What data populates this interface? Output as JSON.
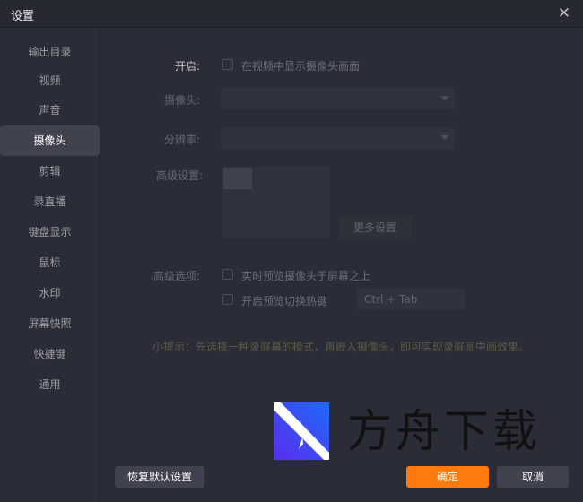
{
  "window": {
    "title": "设置"
  },
  "sidebar": {
    "items": [
      {
        "label": "输出目录"
      },
      {
        "label": "视频"
      },
      {
        "label": "声音"
      },
      {
        "label": "摄像头",
        "active": true
      },
      {
        "label": "剪辑"
      },
      {
        "label": "录直播"
      },
      {
        "label": "键盘显示"
      },
      {
        "label": "鼠标"
      },
      {
        "label": "水印"
      },
      {
        "label": "屏幕快照"
      },
      {
        "label": "快捷键"
      },
      {
        "label": "通用"
      }
    ]
  },
  "camera": {
    "enable_label": "开启:",
    "enable_checkbox": "在视频中显示摄像头画面",
    "camera_label": "摄像头:",
    "camera_value": "",
    "resolution_label": "分辨率:",
    "resolution_value": "",
    "advanced_settings_label": "高级设置:",
    "more_settings": "更多设置",
    "advanced_options_label": "高级选项:",
    "option_preview_on_top": "实时预览摄像头于屏幕之上",
    "option_toggle_hotkey": "开启预览切换热键",
    "hotkey_value": "Ctrl + Tab",
    "tip": "小提示：先选择一种录屏幕的模式，再嵌入摄像头，即可实现录屏画中画效果。"
  },
  "footer": {
    "restore": "恢复默认设置",
    "ok": "确定",
    "cancel": "取消"
  },
  "watermark": {
    "text": "方舟下载"
  },
  "colors": {
    "accent": "#ff7a0e",
    "bg": "#2a2c37"
  }
}
